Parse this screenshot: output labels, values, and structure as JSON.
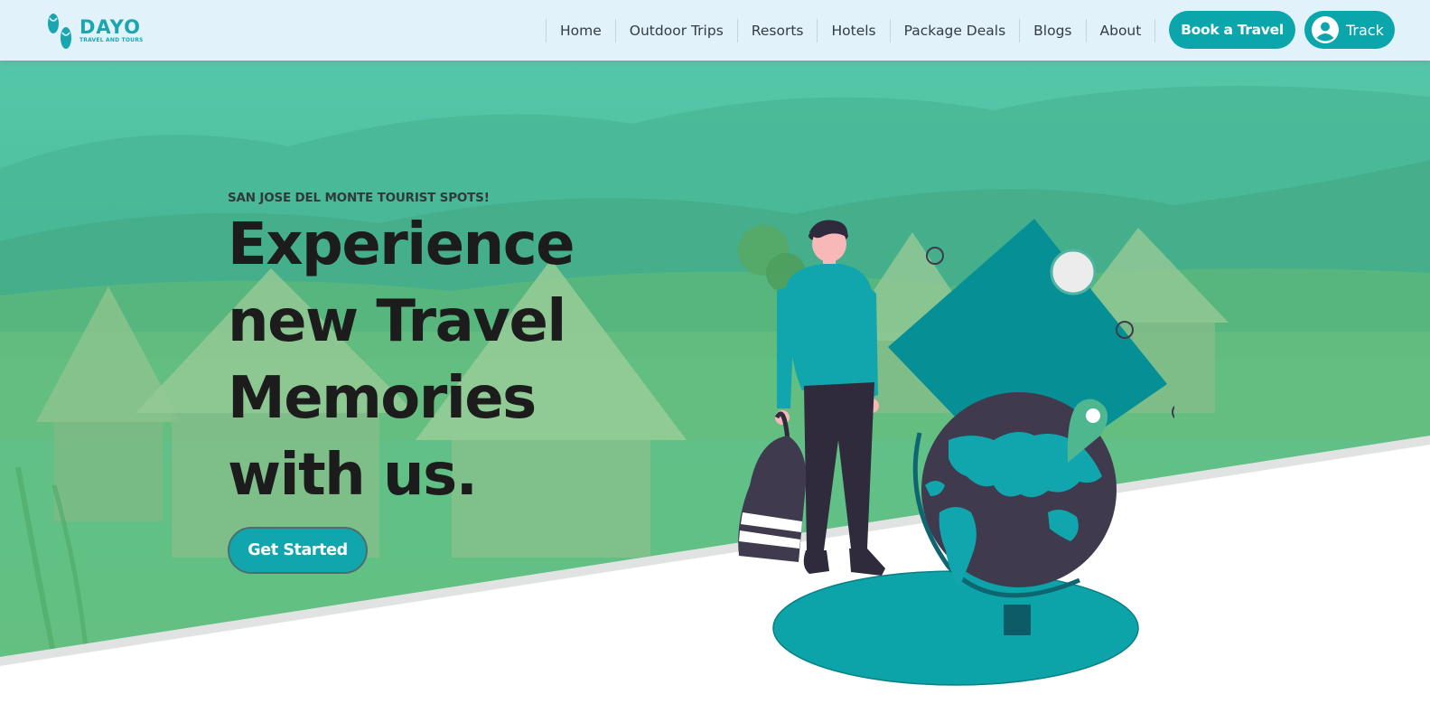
{
  "brand": {
    "name": "DAYO",
    "tagline": "TRAVEL AND TOURS",
    "logo_icon": "flip-flops-icon"
  },
  "nav": {
    "items": [
      {
        "label": "Home"
      },
      {
        "label": "Outdoor Trips"
      },
      {
        "label": "Resorts"
      },
      {
        "label": "Hotels"
      },
      {
        "label": "Package Deals"
      },
      {
        "label": "Blogs"
      },
      {
        "label": "About"
      }
    ],
    "book_label": "Book a Travel",
    "track_label": "Track",
    "track_icon": "user-circle-icon"
  },
  "hero": {
    "eyebrow": "SAN JOSE DEL MONTE TOURIST SPOTS!",
    "headline_lines": [
      "Experience",
      "new Travel",
      "Memories",
      "with us."
    ],
    "cta_label": "Get Started",
    "illustration": "traveler-with-globe-illustration"
  },
  "colors": {
    "header_bg": "#e1f2fb",
    "accent": "#0ba5ac",
    "hero_overlay": "#3fc8a5",
    "text_dark": "#1c1c1c",
    "globe_dark": "#3f3a4e"
  }
}
